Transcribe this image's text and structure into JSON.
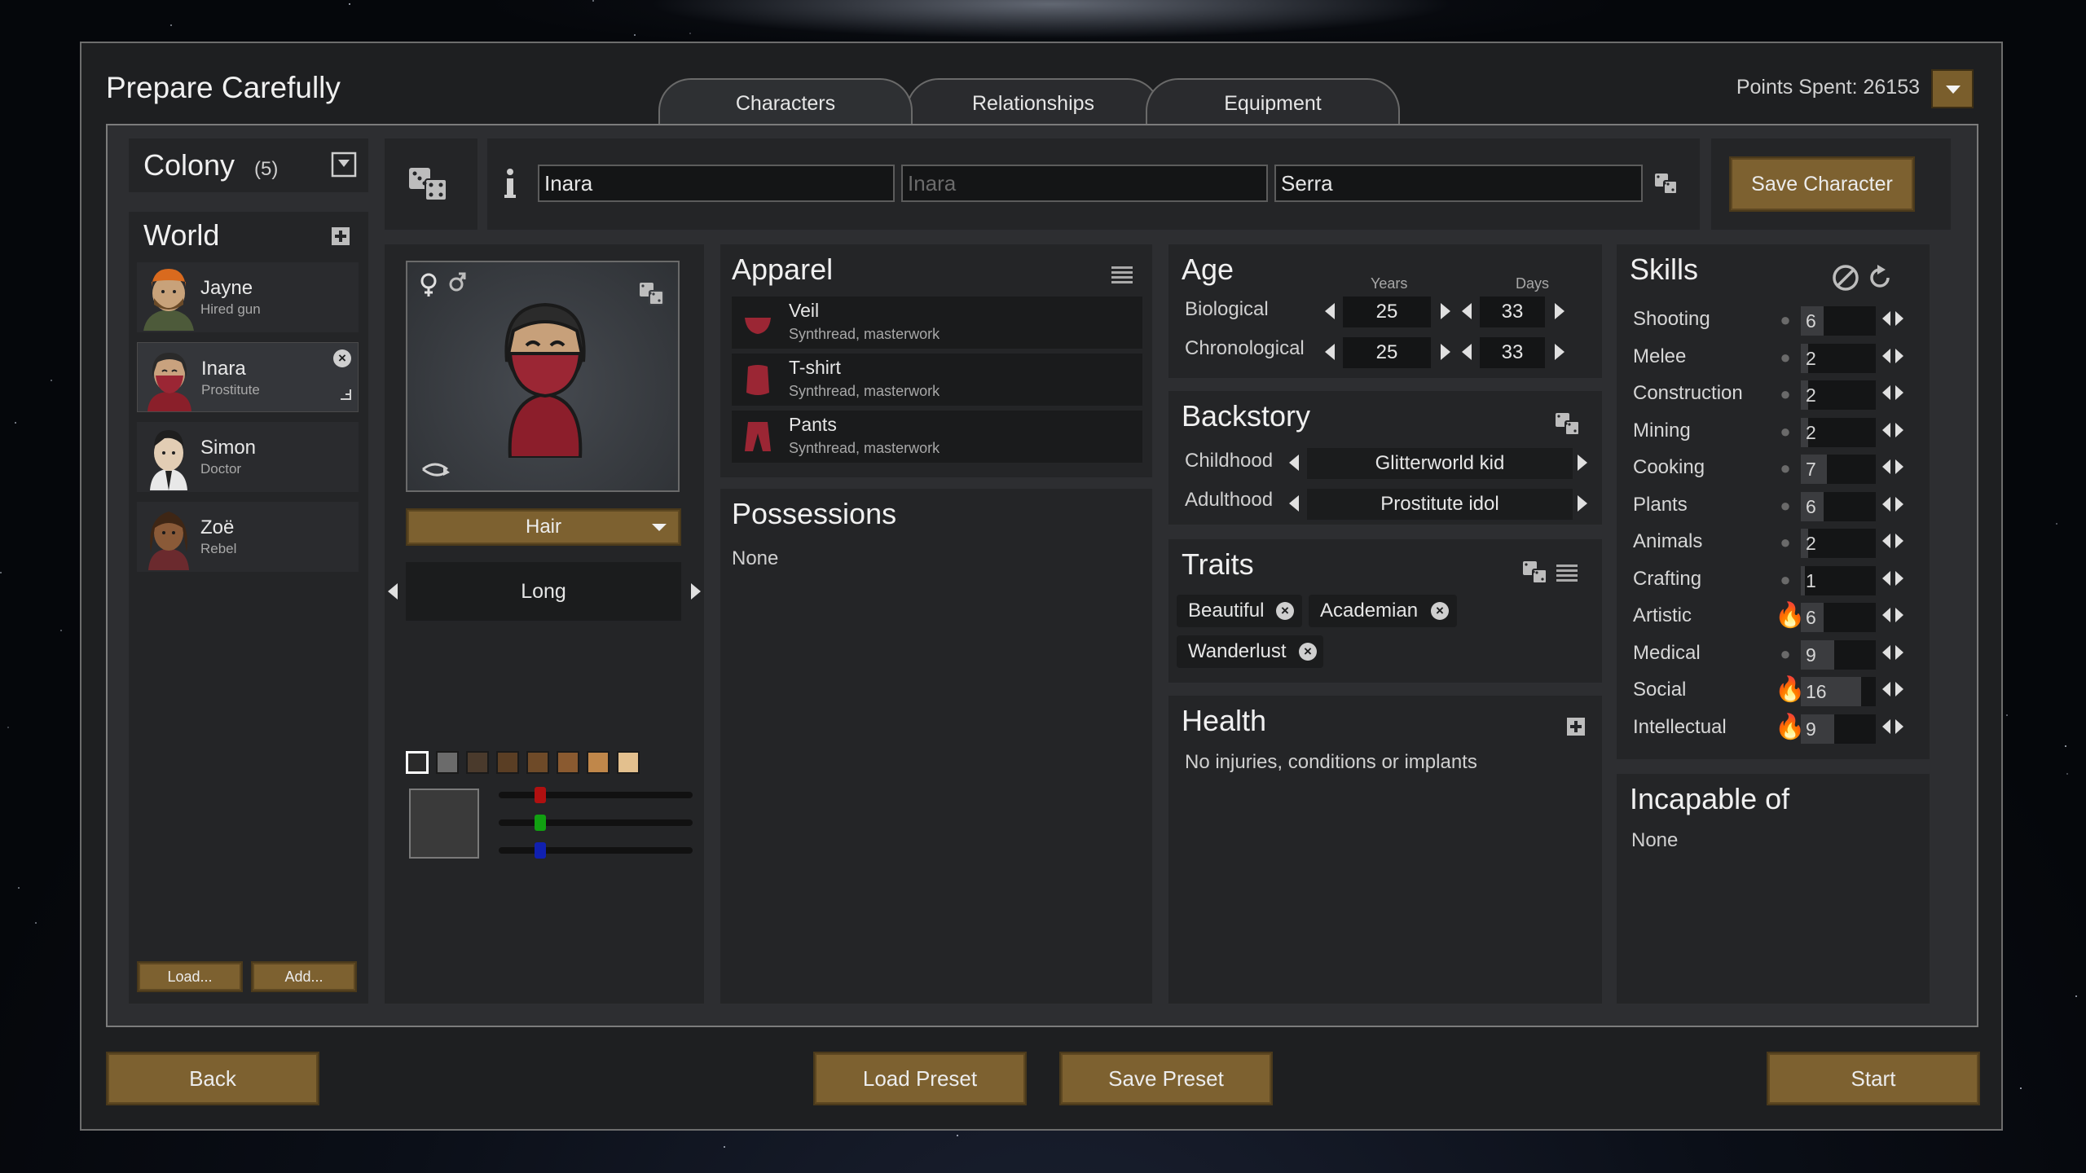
{
  "window": {
    "title": "Prepare Carefully",
    "points": "Points Spent: 26153"
  },
  "tabs": [
    {
      "label": "Characters",
      "active": true
    },
    {
      "label": "Relationships"
    },
    {
      "label": "Equipment"
    }
  ],
  "colony": {
    "title": "Colony",
    "count": "(5)"
  },
  "world": {
    "title": "World"
  },
  "pawns": [
    {
      "name": "Jayne",
      "job": "Hired gun"
    },
    {
      "name": "Inara",
      "job": "Prostitute",
      "selected": true
    },
    {
      "name": "Simon",
      "job": "Doctor"
    },
    {
      "name": "Zoë",
      "job": "Rebel"
    }
  ],
  "pawn_list_buttons": {
    "load": "Load...",
    "add": "Add..."
  },
  "name_fields": {
    "first": "Inara",
    "nick_placeholder": "Inara",
    "last": "Serra"
  },
  "save_character": "Save Character",
  "appearance": {
    "layer_dropdown": "Hair",
    "option": "Long",
    "swatches": [
      "#ffffff",
      "#6b6b6b",
      "#4a3a2c",
      "#5a3e24",
      "#6e4a28",
      "#8a5a30",
      "#c0874a",
      "#e3c08e"
    ],
    "color_preview": "#3a3a3a"
  },
  "apparel": {
    "title": "Apparel",
    "items": [
      {
        "name": "Veil",
        "detail": "Synthread, masterwork"
      },
      {
        "name": "T-shirt",
        "detail": "Synthread, masterwork"
      },
      {
        "name": "Pants",
        "detail": "Synthread, masterwork"
      }
    ]
  },
  "possessions": {
    "title": "Possessions",
    "value": "None"
  },
  "age": {
    "title": "Age",
    "years_header": "Years",
    "days_header": "Days",
    "rows": [
      {
        "label": "Biological",
        "years": "25",
        "days": "33"
      },
      {
        "label": "Chronological",
        "years": "25",
        "days": "33"
      }
    ]
  },
  "backstory": {
    "title": "Backstory",
    "rows": [
      {
        "label": "Childhood",
        "value": "Glitterworld kid"
      },
      {
        "label": "Adulthood",
        "value": "Prostitute idol"
      }
    ]
  },
  "traits": {
    "title": "Traits",
    "items": [
      "Beautiful",
      "Academian",
      "Wanderlust"
    ]
  },
  "health": {
    "title": "Health",
    "value": "No injuries, conditions or implants"
  },
  "skills": {
    "title": "Skills",
    "rows": [
      {
        "name": "Shooting",
        "level": "6",
        "passion": "none",
        "fill": 0.3
      },
      {
        "name": "Melee",
        "level": "2",
        "passion": "none",
        "fill": 0.1
      },
      {
        "name": "Construction",
        "level": "2",
        "passion": "none",
        "fill": 0.1
      },
      {
        "name": "Mining",
        "level": "2",
        "passion": "none",
        "fill": 0.1
      },
      {
        "name": "Cooking",
        "level": "7",
        "passion": "none",
        "fill": 0.35
      },
      {
        "name": "Plants",
        "level": "6",
        "passion": "none",
        "fill": 0.3
      },
      {
        "name": "Animals",
        "level": "2",
        "passion": "none",
        "fill": 0.1
      },
      {
        "name": "Crafting",
        "level": "1",
        "passion": "none",
        "fill": 0.05
      },
      {
        "name": "Artistic",
        "level": "6",
        "passion": "major",
        "fill": 0.3
      },
      {
        "name": "Medical",
        "level": "9",
        "passion": "none",
        "fill": 0.45
      },
      {
        "name": "Social",
        "level": "16",
        "passion": "major",
        "fill": 0.8
      },
      {
        "name": "Intellectual",
        "level": "9",
        "passion": "major",
        "fill": 0.45
      }
    ]
  },
  "incapable": {
    "title": "Incapable of",
    "value": "None"
  },
  "footer": {
    "back": "Back",
    "load_preset": "Load Preset",
    "save_preset": "Save Preset",
    "start": "Start"
  }
}
